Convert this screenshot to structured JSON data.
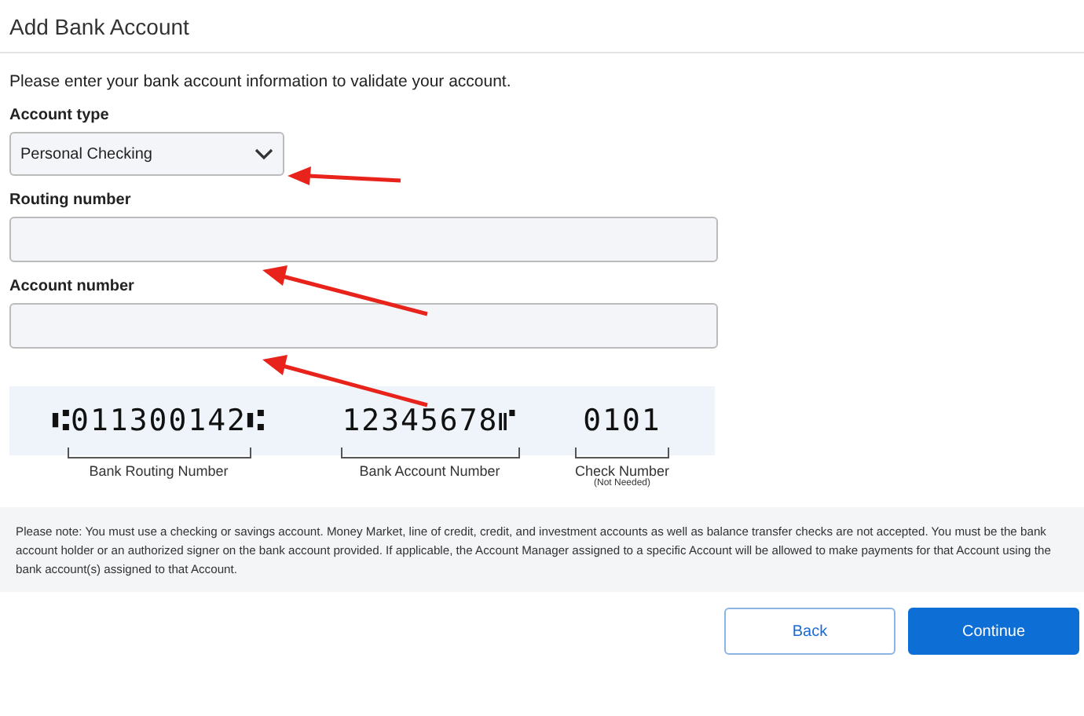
{
  "title": "Add Bank Account",
  "intro": "Please enter your bank account information to validate your account.",
  "fields": [
    {
      "kind": "select",
      "label": "Account type",
      "value": "Personal Checking"
    },
    {
      "kind": "text",
      "label": "Routing number"
    },
    {
      "kind": "text",
      "label": "Account number"
    }
  ],
  "check_diagram": {
    "segments": [
      {
        "micr": "⑆011300142⑆",
        "label": "Bank Routing Number"
      },
      {
        "micr": "12345678⑈",
        "label": "Bank Account Number"
      },
      {
        "micr": "0101",
        "label": "Check Number",
        "sublabel": "(Not Needed)"
      }
    ]
  },
  "note": "Please note: You must use a checking or savings account. Money Market, line of credit, credit, and investment accounts as well as balance transfer checks are not accepted. You must be the bank account holder or an authorized signer on the bank account provided. If applicable, the Account Manager assigned to a specific Account will be allowed to make payments for that Account using the bank account(s) assigned to that Account.",
  "buttons": [
    {
      "kind": "secondary",
      "label": "Back"
    },
    {
      "kind": "primary",
      "label": "Continue"
    }
  ]
}
